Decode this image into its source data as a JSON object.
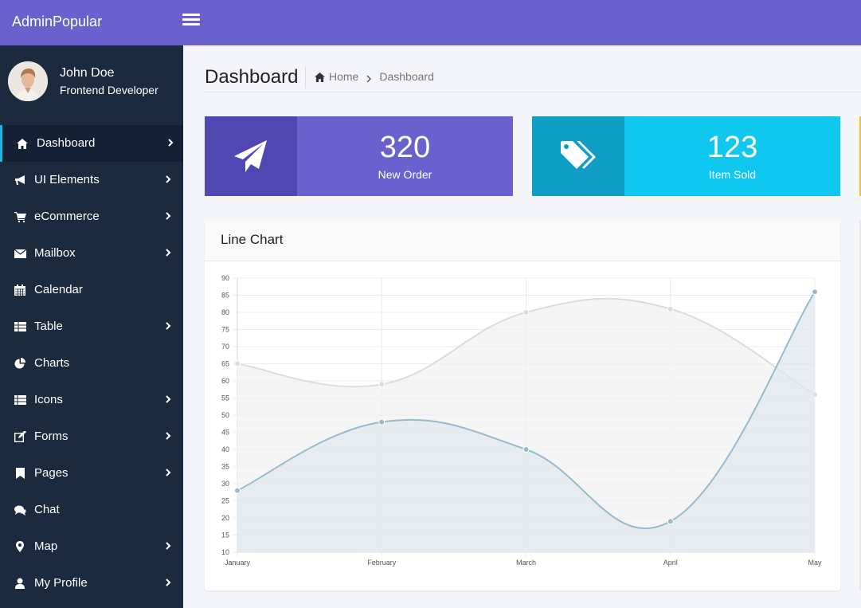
{
  "app": {
    "brand": "AdminPopular"
  },
  "profile": {
    "name": "John Doe",
    "role": "Frontend Developer"
  },
  "sidebar": {
    "items": [
      {
        "label": "Dashboard",
        "icon": "home-icon",
        "has_submenu": true,
        "active": true
      },
      {
        "label": "UI Elements",
        "icon": "bullhorn-icon",
        "has_submenu": true
      },
      {
        "label": "eCommerce",
        "icon": "cart-icon",
        "has_submenu": true
      },
      {
        "label": "Mailbox",
        "icon": "envelope-icon",
        "has_submenu": true
      },
      {
        "label": "Calendar",
        "icon": "calendar-icon",
        "has_submenu": false
      },
      {
        "label": "Table",
        "icon": "table-icon",
        "has_submenu": true
      },
      {
        "label": "Charts",
        "icon": "pie-chart-icon",
        "has_submenu": false
      },
      {
        "label": "Icons",
        "icon": "list-icon",
        "has_submenu": true
      },
      {
        "label": "Forms",
        "icon": "edit-icon",
        "has_submenu": true
      },
      {
        "label": "Pages",
        "icon": "bookmark-icon",
        "has_submenu": true
      },
      {
        "label": "Chat",
        "icon": "comments-icon",
        "has_submenu": false
      },
      {
        "label": "Map",
        "icon": "map-marker-icon",
        "has_submenu": true
      },
      {
        "label": "My Profile",
        "icon": "user-icon",
        "has_submenu": true
      }
    ]
  },
  "header": {
    "title": "Dashboard",
    "breadcrumb": [
      "Home",
      "Dashboard"
    ]
  },
  "stats": [
    {
      "value": "320",
      "label": "New Order",
      "icon": "paper-plane-icon",
      "color": "#6a61cf"
    },
    {
      "value": "123",
      "label": "Item Sold",
      "icon": "tags-icon",
      "color": "#10c7ef"
    }
  ],
  "card": {
    "title": "Line Chart"
  },
  "chart_data": {
    "type": "line",
    "title": "",
    "x": [
      "January",
      "February",
      "March",
      "April",
      "May"
    ],
    "series": [
      {
        "values": [
          65,
          59,
          80,
          81,
          56
        ],
        "color": "#dcdcdc",
        "fill": "#f2f2f2"
      },
      {
        "values": [
          28,
          48,
          40,
          19,
          86
        ],
        "color": "#97bbcd",
        "fill": "#dfe7ec"
      }
    ],
    "yticks": [
      10,
      15,
      20,
      25,
      30,
      35,
      40,
      45,
      50,
      55,
      60,
      65,
      70,
      75,
      80,
      85,
      90
    ],
    "ylim": [
      10,
      90
    ],
    "grid": true,
    "legend": "none"
  },
  "colors": {
    "topbar": "#6a61cf",
    "sidebar": "#1c2a3e",
    "active_indicator": "#17b8e6",
    "stat3_accent": "#f2c12e"
  }
}
